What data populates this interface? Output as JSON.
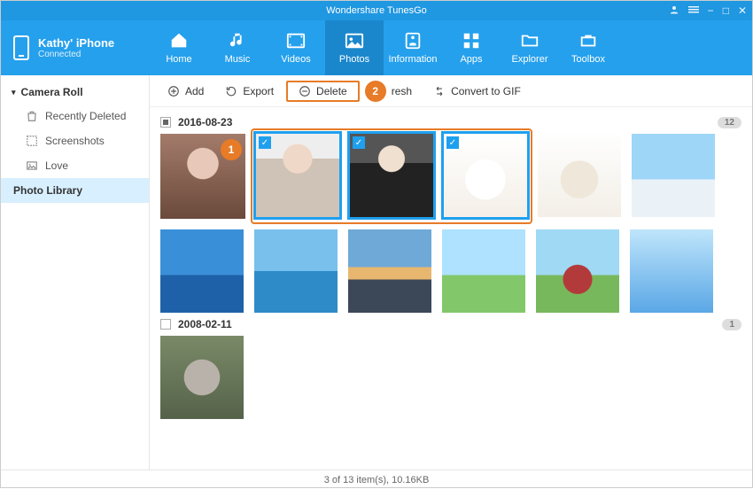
{
  "app_title": "Wondershare TunesGo",
  "window_controls": {
    "user": "user-icon",
    "menu": "menu-icon",
    "min": "−",
    "max": "□",
    "close": "✕"
  },
  "device": {
    "name": "Kathy' iPhone",
    "status": "Connected"
  },
  "nav": {
    "home": "Home",
    "music": "Music",
    "videos": "Videos",
    "photos": "Photos",
    "information": "Information",
    "apps": "Apps",
    "explorer": "Explorer",
    "toolbox": "Toolbox",
    "active": "photos"
  },
  "sidebar": {
    "section": "Camera Roll",
    "items": [
      {
        "label": "Recently Deleted",
        "icon": "trash-icon"
      },
      {
        "label": "Screenshots",
        "icon": "screenshots-icon"
      },
      {
        "label": "Love",
        "icon": "image-icon"
      }
    ],
    "library_label": "Photo Library"
  },
  "toolbar": {
    "add": "Add",
    "export": "Export",
    "delete": "Delete",
    "refresh_tail": "resh",
    "convert": "Convert to GIF"
  },
  "annotations": {
    "step1": "1",
    "step2": "2"
  },
  "groups": [
    {
      "date": "2016-08-23",
      "count": "12",
      "check_state": "partial",
      "photos": [
        {
          "id": "p1",
          "style": "ph-portrait",
          "selected": false,
          "annot_step1": true
        },
        {
          "id": "p2",
          "style": "ph-portrait2",
          "selected": true
        },
        {
          "id": "p3",
          "style": "ph-portrait3",
          "selected": true
        },
        {
          "id": "p4",
          "style": "ph-puppy",
          "selected": true
        },
        {
          "id": "p5",
          "style": "ph-cat",
          "selected": false
        },
        {
          "id": "p6",
          "style": "ph-penguins",
          "selected": false
        },
        {
          "id": "p7",
          "style": "ph-sea1",
          "selected": false
        },
        {
          "id": "p8",
          "style": "ph-sea2",
          "selected": false
        },
        {
          "id": "p9",
          "style": "ph-sunset",
          "selected": false
        },
        {
          "id": "p10",
          "style": "ph-field",
          "selected": false
        },
        {
          "id": "p11",
          "style": "ph-tree",
          "selected": false
        },
        {
          "id": "p12",
          "style": "ph-sky",
          "selected": false
        }
      ]
    },
    {
      "date": "2008-02-11",
      "count": "1",
      "check_state": "empty",
      "photos": [
        {
          "id": "p13",
          "style": "ph-koala",
          "selected": false
        }
      ]
    }
  ],
  "status_bar": "3 of 13 item(s), 10.16KB"
}
